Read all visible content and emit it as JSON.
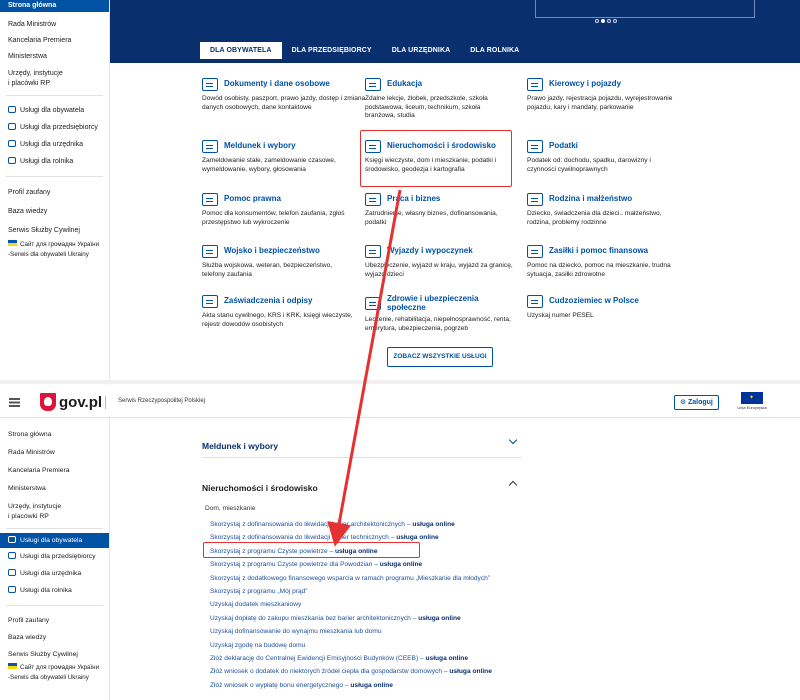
{
  "top": {
    "sidebar": {
      "active_item": "Strona główna",
      "items": [
        "Rada Ministrów",
        "Kancelaria Premiera",
        "Ministerstwa",
        "Urzędy, instytucje",
        "i placówki RP"
      ],
      "service_items": [
        "Usługi dla obywatela",
        "Usługi dla przedsiębiorcy",
        "Usługi dla urzędnika",
        "Usługi dla rolnika"
      ],
      "extra_items": [
        "Profil zaufany",
        "Baza wiedzy",
        "Serwis Służby Cywilnej"
      ],
      "ukraine_1": "Сайт для громадян України",
      "ukraine_2": "-Serwis dla obywateli Ukrainy"
    },
    "tabs": [
      "DLA OBYWATELA",
      "DLA PRZEDSIĘBIORCY",
      "DLA URZĘDNIKA",
      "DLA ROLNIKA"
    ],
    "categories": [
      {
        "title": "Dokumenty i dane osobowe",
        "desc": "Dowód osobisty, paszport, prawo jazdy, dostęp i zmiana danych osobowych, dane kontaktowe"
      },
      {
        "title": "Edukacja",
        "desc": "Zdalne lekcje, żłobek, przedszkole, szkoła podstawowa, liceum, technikum, szkoła branżowa, studia"
      },
      {
        "title": "Kierowcy i pojazdy",
        "desc": "Prawo jazdy, rejestracja pojazdu, wyrejestrowanie pojazdu, kary i mandaty, parkowanie"
      },
      {
        "title": "Meldunek i wybory",
        "desc": "Zameldowanie stałe, zameldowanie czasowe, wymeldowanie, wybory, głosowania"
      },
      {
        "title": "Nieruchomości i środowisko",
        "desc": "Księgi wieczyste, dom i mieszkanie, podatki i środowisko, geodezja i kartografia"
      },
      {
        "title": "Podatki",
        "desc": "Podatek od: dochodu, spadku, darowizny i czynności cywilnoprawnych"
      },
      {
        "title": "Pomoc prawna",
        "desc": "Pomoc dla konsumentów, telefon zaufania, zgłoś przestępstwo lub wykroczenie"
      },
      {
        "title": "Praca i biznes",
        "desc": "Zatrudnienie, własny biznes, dofinansowania, podatki"
      },
      {
        "title": "Rodzina i małżeństwo",
        "desc": "Dziecko, świadczenia dla dzieci.. małżeństwo, rodzina, problemy rodzinne"
      },
      {
        "title": "Wojsko i bezpieczeństwo",
        "desc": "Służba wojskowa, weteran, bezpieczeństwo, telefony zaufania"
      },
      {
        "title": "Wyjazdy i wypoczynek",
        "desc": "Ubezpieczenie, wyjazd w kraju, wyjazd za granicę, wyjazd dzieci"
      },
      {
        "title": "Zasiłki i pomoc finansowa",
        "desc": "Pomoc na dziecko, pomoc na mieszkanie, trudna sytuacja, zasiłki zdrowotne"
      },
      {
        "title": "Zaświadczenia i odpisy",
        "desc": "Akta stanu cywilnego, KRS i KRK, księgi wieczyste, rejestr dowodów osobistych"
      },
      {
        "title": "Zdrowie i ubezpieczenia społeczne",
        "desc": "Leczenie, rehabilitacja, niepełnosprawność, renta, emerytura, ubezpieczenia, pogrzeb"
      },
      {
        "title": "Cudzoziemiec w Polsce",
        "desc": "Uzyskaj numer PESEL"
      }
    ],
    "all_services_button": "ZOBACZ WSZYSTKIE USŁUGI"
  },
  "header": {
    "logo": "gov.pl",
    "serwis": "Serwis Rzeczypospolitej Polskiej",
    "login": "Zaloguj",
    "eu_label": "Unia Europejska"
  },
  "bottom": {
    "sidebar": {
      "items": [
        "Strona główna",
        "Rada Ministrów",
        "Kancelaria Premiera",
        "Ministerstwa",
        "Urzędy, instytucje",
        "i placówki RP"
      ],
      "active_item": "Usługi dla obywatela",
      "service_items": [
        "Usługi dla przedsiębiorcy",
        "Usługi dla urzędnika",
        "Usługi dla rolnika"
      ],
      "extra_items": [
        "Profil zaufany",
        "Baza wiedzy",
        "Serwis Służby Cywilnej"
      ],
      "ukraine_1": "Сайт для громадян України",
      "ukraine_2": "-Serwis dla obywateli Ukrainy"
    },
    "accordion_1": "Meldunek i wybory",
    "accordion_2": "Nieruchomości i środowisko",
    "group_label": "Dom, mieszkanie",
    "online_suffix": "usługa online",
    "links": [
      {
        "text": "Skorzystaj z dofinansowania do likwidacji barier architektonicznych",
        "online": true
      },
      {
        "text": "Skorzystaj z dofinansowania do likwidacji barier technicznych",
        "online": true
      },
      {
        "text": "Skorzystaj z programu Czyste powietrze",
        "online": true
      },
      {
        "text": "Skorzystaj z programu Czyste powietrze dla Powodzian",
        "online": true
      },
      {
        "text": "Skorzystaj z dodatkowego finansowego wsparcia w ramach programu „Mieszkanie dla młodych”",
        "online": false
      },
      {
        "text": "Skorzystaj z programu „Mój prąd”",
        "online": false
      },
      {
        "text": "Uzyskaj dodatek mieszkaniowy",
        "online": false
      },
      {
        "text": "Uzyskaj dopłatę do zakupu mieszkania bez barier architektonicznych",
        "online": true
      },
      {
        "text": "Uzyskaj dofinansowanie do wynajmu mieszkania lub domu",
        "online": false
      },
      {
        "text": "Uzyskaj zgodę na budowę domu",
        "online": false
      },
      {
        "text": "Złóż deklarację do Centralnej Ewidencji Emisyjności Budynków (CEEB)",
        "online": true
      },
      {
        "text": "Złóż wniosek o dodatek do niektórych źródeł ciepła dla gospodarstw domowych",
        "online": true
      },
      {
        "text": "Złóż wniosek o wypłatę bonu energetycznego",
        "online": true
      }
    ]
  },
  "colors": {
    "accent": "#0052a5",
    "navy": "#0a2f6e",
    "highlight": "#e53131"
  }
}
